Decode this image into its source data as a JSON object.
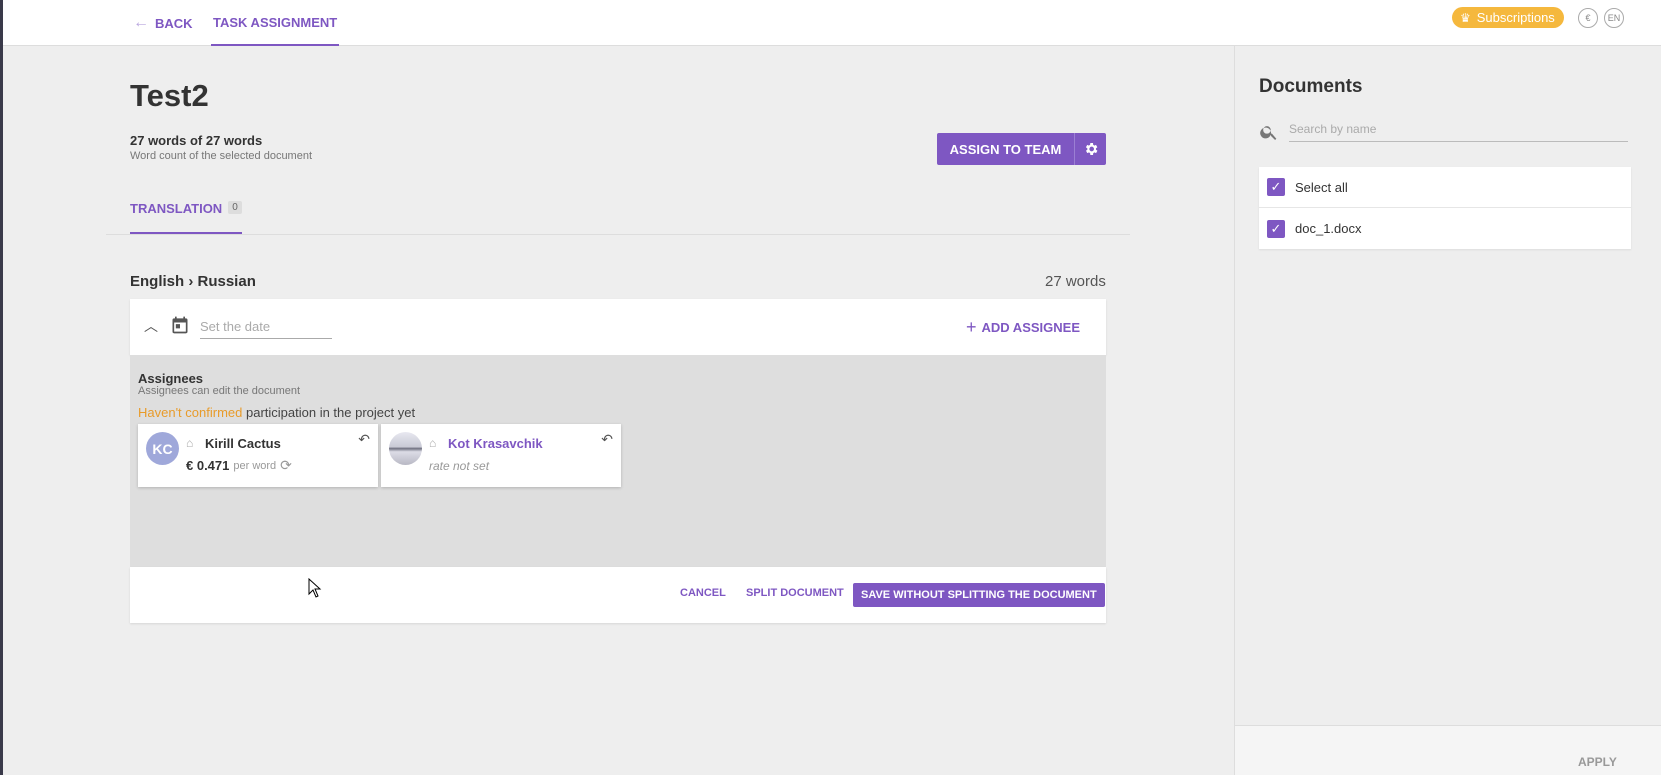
{
  "topbar": {
    "back_label": "BACK",
    "tab_label": "TASK ASSIGNMENT",
    "subscriptions_label": "Subscriptions",
    "currency_symbol": "€",
    "language_code": "EN",
    "accent_color": "#7e57c2",
    "subscriptions_color": "#f5b83d"
  },
  "project": {
    "title": "Test2",
    "word_count": "27 words of 27 words",
    "word_count_sub": "Word count of the selected document",
    "assign_button": "ASSIGN TO TEAM"
  },
  "tabs": [
    {
      "label": "TRANSLATION",
      "count": "0"
    }
  ],
  "stage": {
    "language_pair": "English › Russian",
    "words": "27 words",
    "date_placeholder": "Set the date",
    "add_assignee": "ADD ASSIGNEE",
    "assignees_title": "Assignees",
    "assignees_sub": "Assignees can edit the document",
    "note_warn": "Haven't confirmed",
    "note_rest": " participation in the project yet",
    "people": [
      {
        "initials": "KC",
        "name": "Kirill Cactus",
        "rate": "€ 0.471",
        "rate_unit": "per word"
      },
      {
        "name": "Kot Krasavchik",
        "rate_note": "rate not set"
      }
    ],
    "cancel": "CANCEL",
    "split": "SPLIT DOCUMENT",
    "save": "SAVE WITHOUT SPLITTING THE DOCUMENT"
  },
  "documents": {
    "title": "Documents",
    "search_placeholder": "Search by name",
    "items": [
      {
        "label": "Select all",
        "checked": true
      },
      {
        "label": "doc_1.docx",
        "checked": true
      }
    ],
    "apply": "APPLY"
  }
}
